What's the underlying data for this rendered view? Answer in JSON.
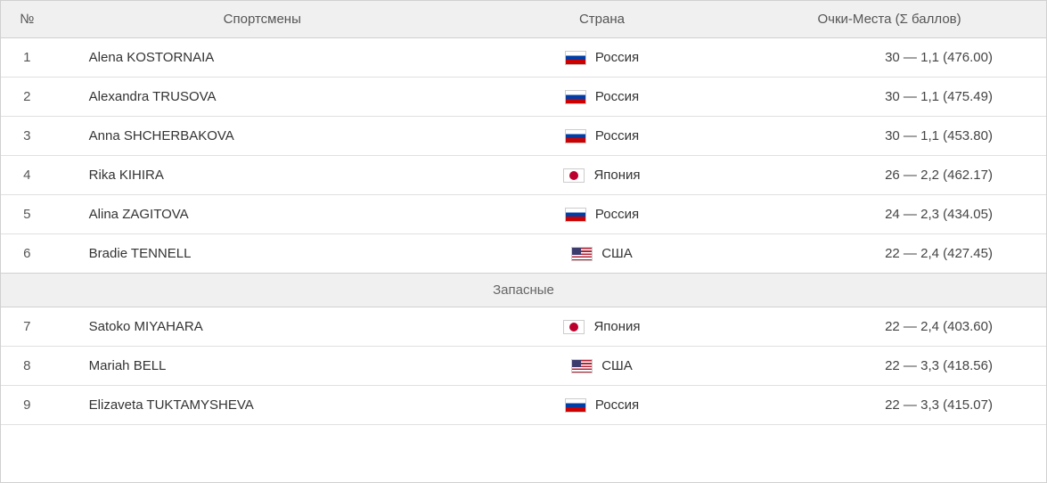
{
  "table": {
    "headers": {
      "num": "№",
      "athlete": "Спортсмены",
      "country": "Страна",
      "score": "Очки-Места (Σ баллов)"
    },
    "separator": "Запасные",
    "rows": [
      {
        "num": "1",
        "athlete": "Alena KOSTORNAIA",
        "country_name": "Россия",
        "country_flag": "russia",
        "score": "30 — 1,1 (476.00)"
      },
      {
        "num": "2",
        "athlete": "Alexandra TRUSOVA",
        "country_name": "Россия",
        "country_flag": "russia",
        "score": "30 — 1,1 (475.49)"
      },
      {
        "num": "3",
        "athlete": "Anna SHCHERBAKOVA",
        "country_name": "Россия",
        "country_flag": "russia",
        "score": "30 — 1,1 (453.80)"
      },
      {
        "num": "4",
        "athlete": "Rika KIHIRA",
        "country_name": "Япония",
        "country_flag": "japan",
        "score": "26 — 2,2 (462.17)"
      },
      {
        "num": "5",
        "athlete": "Alina ZAGITOVA",
        "country_name": "Россия",
        "country_flag": "russia",
        "score": "24 — 2,3 (434.05)"
      },
      {
        "num": "6",
        "athlete": "Bradie TENNELL",
        "country_name": "США",
        "country_flag": "usa",
        "score": "22 — 2,4 (427.45)"
      },
      {
        "num": "7",
        "athlete": "Satoko MIYAHARA",
        "country_name": "Япония",
        "country_flag": "japan",
        "score": "22 — 2,4 (403.60)"
      },
      {
        "num": "8",
        "athlete": "Mariah BELL",
        "country_name": "США",
        "country_flag": "usa",
        "score": "22 — 3,3 (418.56)"
      },
      {
        "num": "9",
        "athlete": "Elizaveta TUKTAMYSHEVA",
        "country_name": "Россия",
        "country_flag": "russia",
        "score": "22 — 3,3 (415.07)"
      }
    ]
  }
}
